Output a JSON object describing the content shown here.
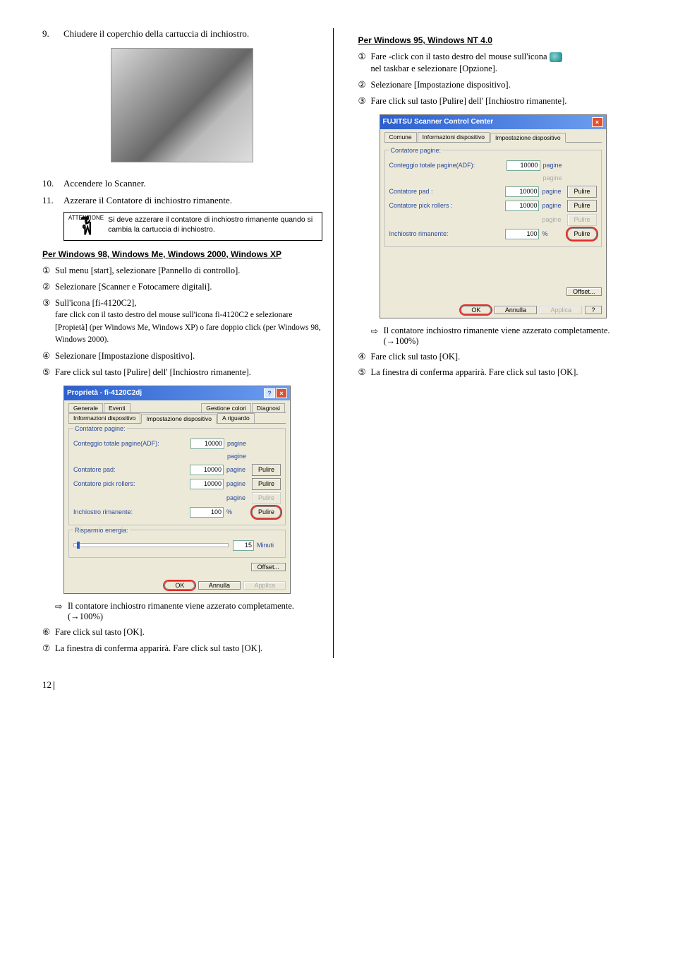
{
  "left": {
    "step9_num": "9.",
    "step9_txt": "Chiudere il coperchio della cartuccia di inchiostro.",
    "step10_num": "10.",
    "step10_txt": "Accendere lo Scanner.",
    "step11_num": "11.",
    "step11_txt": "Azzerare il Contatore di inchiostro rimanente.",
    "att_label": "ATTENZIONE",
    "att_text": "Si deve azzerare il contatore di inchiostro rimanente quando si cambia la cartuccia di inchiostro.",
    "head1": "Per Windows 98, Windows Me, Windows 2000, Windows XP",
    "s1_c": "①",
    "s1": "Sul menu [start], selezionare [Pannello di controllo].",
    "s2_c": "②",
    "s2": "Selezionare [Scanner e Fotocamere digitali].",
    "s3_c": "③",
    "s3_a": "Sull'icona [fi-4120C2],",
    "s3_b": "fare click con il tasto destro del mouse sull'icona fi-4120C2 e selezionare [Propietà] (per Windows Me, Windows XP) o fare doppio click (per Windows 98, Windows 2000).",
    "s4_c": "④",
    "s4": "Selezionare [Impostazione dispositivo].",
    "s5_c": "⑤",
    "s5": "Fare click sul tasto [Pulire] dell' [Inchiostro rimanente].",
    "res_arrow": "⇨",
    "res_txt": "Il contatore inchiostro rimanente viene azzerato completamente. (→100%)",
    "s6_c": "⑥",
    "s6": "Fare click sul tasto [OK].",
    "s7_c": "⑦",
    "s7": "La finestra di conferma apparirà. Fare click sul tasto [OK]."
  },
  "right": {
    "head": "Per Windows 95, Windows NT 4.0",
    "s1_c": "①",
    "s1_a": "Fare -click con il tasto destro del mouse sull'icona",
    "s1_b": "nel taskbar e selezionare [Opzione].",
    "s2_c": "②",
    "s2": "Selezionare [Impostazione dispositivo].",
    "s3_c": "③",
    "s3": "Fare click sul tasto [Pulire] dell' [Inchiostro rimanente].",
    "res_arrow": "⇨",
    "res_txt": "Il contatore inchiostro rimanente viene azzerato completamente. (→100%)",
    "s4_c": "④",
    "s4": "Fare click sul tasto [OK].",
    "s5_c": "⑤",
    "s5": "La finestra di conferma apparirà. Fare click sul tasto [OK]."
  },
  "dlg1": {
    "title": "Proprietà - fi-4120C2dj",
    "tab_generale": "Generale",
    "tab_eventi": "Eventi",
    "tab_gest": "Gestione colori",
    "tab_diag": "Diagnosi",
    "tab_info": "Informazioni dispositivo",
    "tab_imp": "Impostazione dispositivo",
    "tab_al": "A riguardo",
    "grp1": "Contatore pagine:",
    "r1_l": "Conteggio totale pagine(ADF):",
    "r1_v": "10000",
    "r1_u": "pagine",
    "r_blank_u": "pagine",
    "r2_l": "Contatore pad:",
    "r2_v": "10000",
    "r2_u": "pagine",
    "r2_b": "Pulire",
    "r3_l": "Contatore pick rollers:",
    "r3_v": "10000",
    "r3_u": "pagine",
    "r3_b": "Pulire",
    "r_bl2_u": "pagine",
    "r_bl2_b": "Pulire",
    "r4_l": "Inchiostro rimanente:",
    "r4_v": "100",
    "r4_u": "%",
    "r4_b": "Pulire",
    "grp2": "Risparmio energia:",
    "sl_v": "15",
    "sl_u": "Minuti",
    "btn_offset": "Offset...",
    "btn_ok": "OK",
    "btn_ann": "Annulla",
    "btn_app": "Applica"
  },
  "dlg2": {
    "title": "FUJITSU Scanner Control Center",
    "tab_com": "Comune",
    "tab_info": "Informazioni dispositivo",
    "tab_imp": "Impostazione dispositivo",
    "grp1": "Contatore pagine:",
    "r1_l": "Conteggio totale pagine(ADF):",
    "r1_v": "10000",
    "r1_u": "pagine",
    "r_blank_u": "pagine",
    "r2_l": "Contatore pad :",
    "r2_v": "10000",
    "r2_u": "pagine",
    "r2_b": "Pulire",
    "r3_l": "Contatore pick rollers :",
    "r3_v": "10000",
    "r3_u": "pagine",
    "r3_b": "Pulire",
    "r_bl2_u": "pagine",
    "r_bl2_b": "Pulire",
    "r4_l": "Inchiostro rimanente:",
    "r4_v": "100",
    "r4_u": "%",
    "r4_b": "Pulire",
    "btn_offset": "Offset...",
    "btn_ok": "OK",
    "btn_ann": "Annulla",
    "btn_app": "Applica",
    "btn_q": "?"
  },
  "pagenum": "12"
}
